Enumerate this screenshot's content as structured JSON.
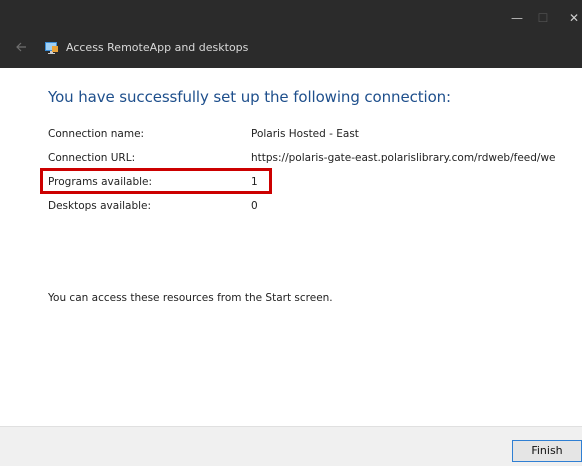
{
  "window": {
    "title": "Access RemoteApp and desktops",
    "back_icon": "back-arrow-icon",
    "minimize_glyph": "—",
    "maximize_glyph": "☐",
    "close_glyph": "✕"
  },
  "content": {
    "heading": "You have successfully set up the following connection:",
    "rows": [
      {
        "label": "Connection name:",
        "value": "Polaris Hosted - East"
      },
      {
        "label": "Connection URL:",
        "value": "https://polaris-gate-east.polarislibrary.com/rdweb/feed/we"
      },
      {
        "label": "Programs available:",
        "value": "1"
      },
      {
        "label": "Desktops available:",
        "value": "0"
      }
    ],
    "info": "You can access these resources from the Start screen."
  },
  "footer": {
    "finish_label": "Finish"
  },
  "colors": {
    "titlebar": "#2b2b2b",
    "heading": "#1e4f8c",
    "highlight": "#cc0000",
    "footer": "#f0f0f0",
    "button_border": "#2f7fd3"
  }
}
